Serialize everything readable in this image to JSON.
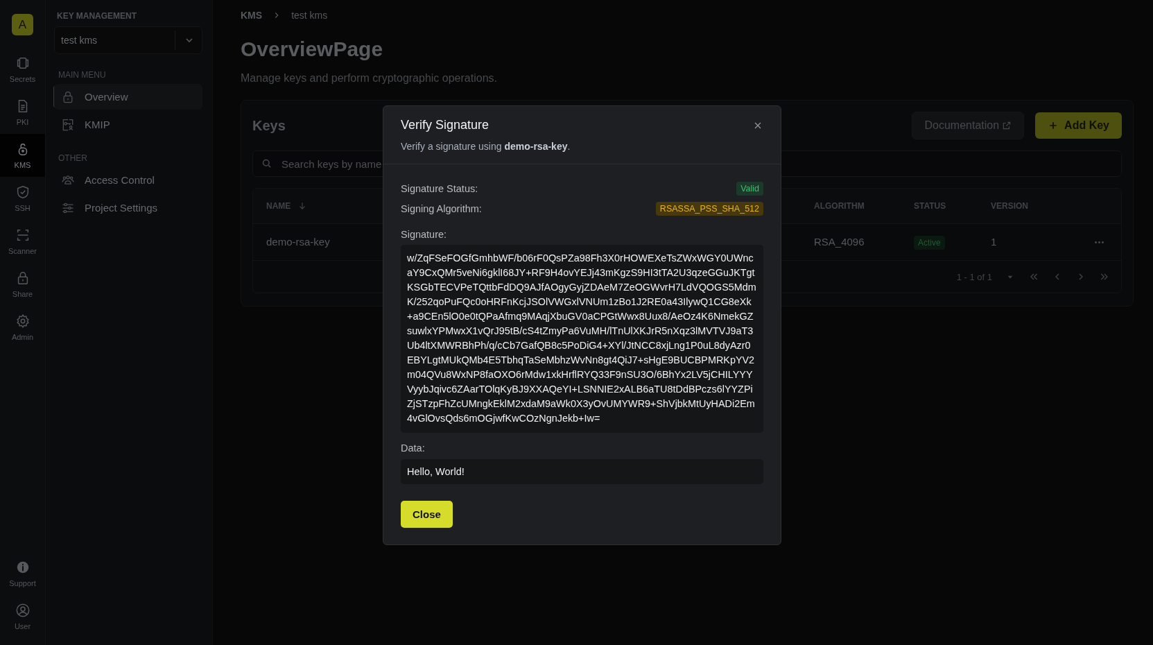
{
  "rail": {
    "avatar": "A",
    "items": [
      {
        "label": "Secrets",
        "selected": false
      },
      {
        "label": "PKI",
        "selected": false
      },
      {
        "label": "KMS",
        "selected": true
      },
      {
        "label": "SSH",
        "selected": false
      },
      {
        "label": "Scanner",
        "selected": false
      },
      {
        "label": "Share",
        "selected": false
      },
      {
        "label": "Admin",
        "selected": false
      }
    ],
    "bottom_items": [
      {
        "label": "Support"
      },
      {
        "label": "User"
      }
    ]
  },
  "sidebar": {
    "section_title": "KEY MANAGEMENT",
    "project_select": {
      "value": "test kms"
    },
    "groups": [
      {
        "title": "MAIN MENU",
        "items": [
          {
            "label": "Overview",
            "selected": true
          },
          {
            "label": "KMIP",
            "selected": false
          }
        ]
      },
      {
        "title": "OTHER",
        "items": [
          {
            "label": "Access Control",
            "selected": false
          },
          {
            "label": "Project Settings",
            "selected": false
          }
        ]
      }
    ]
  },
  "breadcrumb": [
    "KMS",
    "test kms"
  ],
  "page": {
    "title": "OverviewPage",
    "subtitle": "Manage keys and perform cryptographic operations."
  },
  "keys_panel": {
    "title": "Keys",
    "documentation_button": "Documentation",
    "add_button": "Add Key",
    "search": {
      "placeholder": "Search keys by name"
    },
    "columns": [
      {
        "label": "NAME"
      },
      {
        "label": "ALGORITHM"
      },
      {
        "label": "STATUS"
      },
      {
        "label": "VERSION"
      }
    ],
    "rows": [
      {
        "name": "demo-rsa-key",
        "algorithm": "RSA_4096",
        "status": "Active",
        "version": "1"
      }
    ],
    "pagination": "1 - 1 of 1"
  },
  "modal": {
    "title": "Verify Signature",
    "description": "Verify a signature using **demo-rsa-key**.",
    "status_label": "Signature Status:",
    "status": "Valid",
    "algorithm_label": "Signing Algorithm:",
    "algorithm": "RSASSA_PSS_SHA_512",
    "signature_label": "Signature:",
    "signature": "w/ZqFSeFOGfGmhbWF/b06rF0QsPZa98Fh3X0rHOWEXeTsZWxWGY0UWncaY9CxQMr5veNi6gklI68JY+RF9H4ovYEJj43mKgzS9HI3tTA2U3qzeGGuJKTgtKSGbTECVPeTQttbFdDQ9AJfAOgyGyjZDAeM7ZeOGWvrH7LdVQOGS5MdmK/252qoPuFQc0oHRFnKcjJSOlVWGxlVNUm1zBo1J2RE0a43IlywQ1CG8eXk+a9CEn5lO0e0tQPaAfmq9MAqjXbuGV0aCPGtWwx8Uux8/AeOz4K6NmekGZsuwlxYPMwxX1vQrJ95tB/cS4tZmyPa6VuMH/lTnUlXKJrR5nXqz3lMVTVJ9aT3Ub4ltXMWRBhPh/q/cCb7GafQB8c5PoDiG4+XYl/JtNCC8xjLng1P0uL8dyAzr0EBYLgtMUkQMb4E5TbhqTaSeMbhzWvNn8gt4QiJ7+sHgE9BUCBPMRKpYV2m04QVu8WxNP8faOXO6rMdw1xkHrflRYQ33F9nSU3O/6BhYx2LV5jCHILYYYVyybJqivc6ZAarTOlqKyBJ9XXAQeYI+LSNNIE2xALB6aTU8tDdBPczs6lYYZPiZjSTzpFhZcUMngkEklM2xdaM9aWk0X3yOvUMYWR9+ShVjbkMtUyHADi2Em4vGlOvsQds6mOGjwfKwCOzNgnJekb+Iw=",
    "data_label": "Data:",
    "data_value": "Hello, World!",
    "close_button": "Close"
  }
}
